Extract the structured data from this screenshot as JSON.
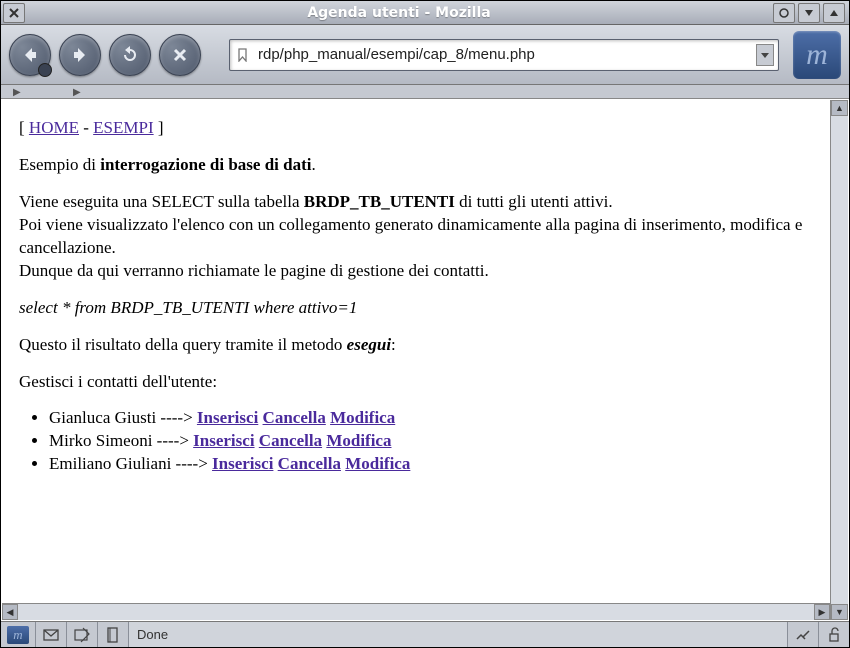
{
  "window": {
    "title": "Agenda utenti - Mozilla",
    "url": "rdp/php_manual/esempi/cap_8/menu.php"
  },
  "nav": {
    "home_label": "HOME",
    "esempi_label": "ESEMPI"
  },
  "para1": {
    "p1": "Esempio di ",
    "bold": "interrogazione di base di dati",
    "p2": "."
  },
  "para2": {
    "l1a": "Viene eseguita una SELECT sulla tabella ",
    "l1b": "BRDP_TB_UTENTI",
    "l1c": " di tutti gli utenti attivi.",
    "l2": "Poi viene visualizzato l'elenco con un collegamento generato dinamicamente alla pagina di inserimento, modifica e cancellazione.",
    "l3": "Dunque da qui verranno richiamate le pagine di gestione dei contatti."
  },
  "sql": "select * from BRDP_TB_UTENTI where attivo=1",
  "para3": {
    "a": "Questo il risultato della query tramite il metodo ",
    "b": "esegui",
    "c": ":"
  },
  "para4": "Gestisci i contatti dell'utente:",
  "actions": {
    "insert": "Inserisci",
    "delete": "Cancella",
    "modify": "Modifica"
  },
  "users": [
    {
      "name": "Gianluca Giusti",
      "arrow": " ----> "
    },
    {
      "name": "Mirko Simeoni",
      "arrow": " ----> "
    },
    {
      "name": "Emiliano Giuliani",
      "arrow": " ----> "
    }
  ],
  "status": {
    "text": "Done"
  }
}
